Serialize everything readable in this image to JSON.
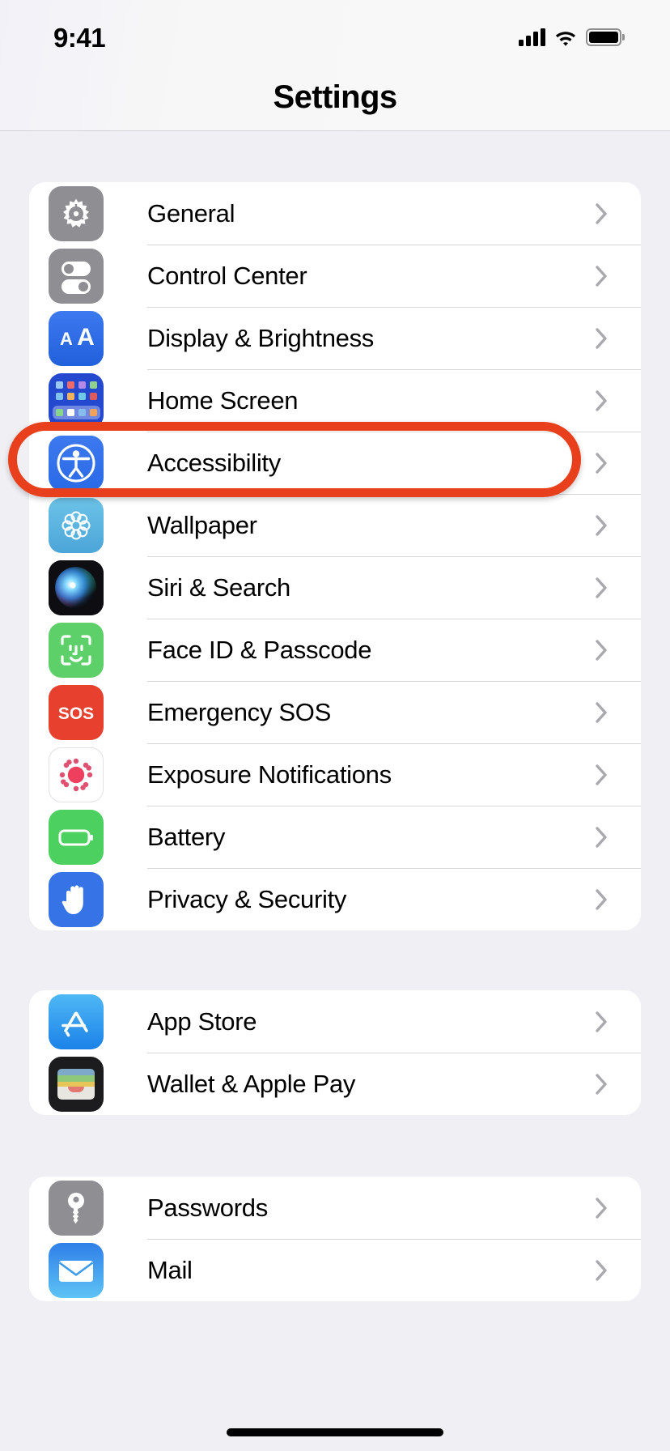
{
  "status_bar": {
    "time": "9:41",
    "signal_icon": "cellular-signal-icon",
    "wifi_icon": "wifi-icon",
    "battery_icon": "battery-icon"
  },
  "header": {
    "title": "Settings"
  },
  "colors": {
    "background": "#efeff4",
    "card": "#ffffff",
    "separator": "#d7d7da",
    "highlight_ring": "#e8401c",
    "chevron": "#8e8e93"
  },
  "annotation": {
    "type": "highlight-ring",
    "target_row": "Accessibility",
    "color": "#e8401c"
  },
  "groups": [
    {
      "id": "group-system",
      "rows": [
        {
          "label": "General",
          "icon": "gear-icon",
          "icon_bg": "#8e8e93",
          "chevron": "›"
        },
        {
          "label": "Control Center",
          "icon": "control-center-icon",
          "icon_bg": "#8e8e93",
          "chevron": "›"
        },
        {
          "label": "Display & Brightness",
          "icon": "display-brightness-aa-icon",
          "icon_bg": "#2f6ee8",
          "chevron": "›"
        },
        {
          "label": "Home Screen",
          "icon": "home-screen-grid-icon",
          "icon_bg": "#2449cf",
          "chevron": "›"
        },
        {
          "label": "Accessibility",
          "icon": "accessibility-person-icon",
          "icon_bg": "#2f6ee8",
          "chevron": "›"
        },
        {
          "label": "Wallpaper",
          "icon": "wallpaper-flower-icon",
          "icon_bg": "#5ab4e0",
          "chevron": "›"
        },
        {
          "label": "Siri & Search",
          "icon": "siri-orb-icon",
          "icon_bg": "#131317",
          "chevron": "›"
        },
        {
          "label": "Face ID & Passcode",
          "icon": "face-id-icon",
          "icon_bg": "#5ed06a",
          "chevron": "›"
        },
        {
          "label": "Emergency SOS",
          "icon": "emergency-sos-icon",
          "icon_bg": "#e8402f",
          "chevron": "›"
        },
        {
          "label": "Exposure Notifications",
          "icon": "exposure-notifications-icon",
          "icon_bg": "#ffffff",
          "chevron": "›"
        },
        {
          "label": "Battery",
          "icon": "battery-green-icon",
          "icon_bg": "#4cd060",
          "chevron": "›"
        },
        {
          "label": "Privacy & Security",
          "icon": "privacy-hand-icon",
          "icon_bg": "#3573e6",
          "chevron": "›"
        }
      ]
    },
    {
      "id": "group-stores",
      "rows": [
        {
          "label": "App Store",
          "icon": "app-store-icon",
          "icon_bg": "#2f9ff0",
          "chevron": "›"
        },
        {
          "label": "Wallet & Apple Pay",
          "icon": "wallet-icon",
          "icon_bg": "#1c1c1e",
          "chevron": "›"
        }
      ]
    },
    {
      "id": "group-accounts",
      "rows": [
        {
          "label": "Passwords",
          "icon": "key-icon",
          "icon_bg": "#8e8e93",
          "chevron": "›"
        },
        {
          "label": "Mail",
          "icon": "mail-icon",
          "icon_bg": "#2f8cf0",
          "chevron": "›"
        }
      ]
    }
  ]
}
